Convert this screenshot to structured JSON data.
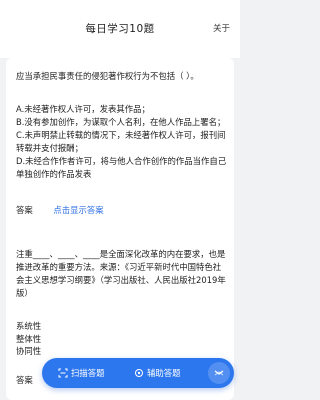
{
  "header": {
    "title": "每日学习10题",
    "about": "关于"
  },
  "question1": {
    "text": "应当承担民事责任的侵犯著作权行为不包括（ ）。",
    "options": [
      "A.未经著作权人许可，发表其作品；",
      "B.没有参加创作，为谋取个人名利，在他人作品上署名；",
      "C.未声明禁止转载的情况下，未经著作权人许可，报刊间转载并支付报酬；",
      "D.未经合作作者许可，将与他人合作创作的作品当作自己单独创作的作品发表"
    ],
    "answer_label": "答案",
    "show_answer": "点击显示答案"
  },
  "question2": {
    "text": "注重____、____、____是全面深化改革的内在要求，也是推进改革的重要方法。来源：《习近平新时代中国特色社会主义思想学习纲要》（学习出版社、人民出版社2019年版）",
    "options": [
      "系统性",
      "整体性",
      "协同性"
    ],
    "answer_label": "答案"
  },
  "floating_bar": {
    "scan_label": "扫描答题",
    "assist_label": "辅助答题",
    "accent": "#2c77ee"
  }
}
